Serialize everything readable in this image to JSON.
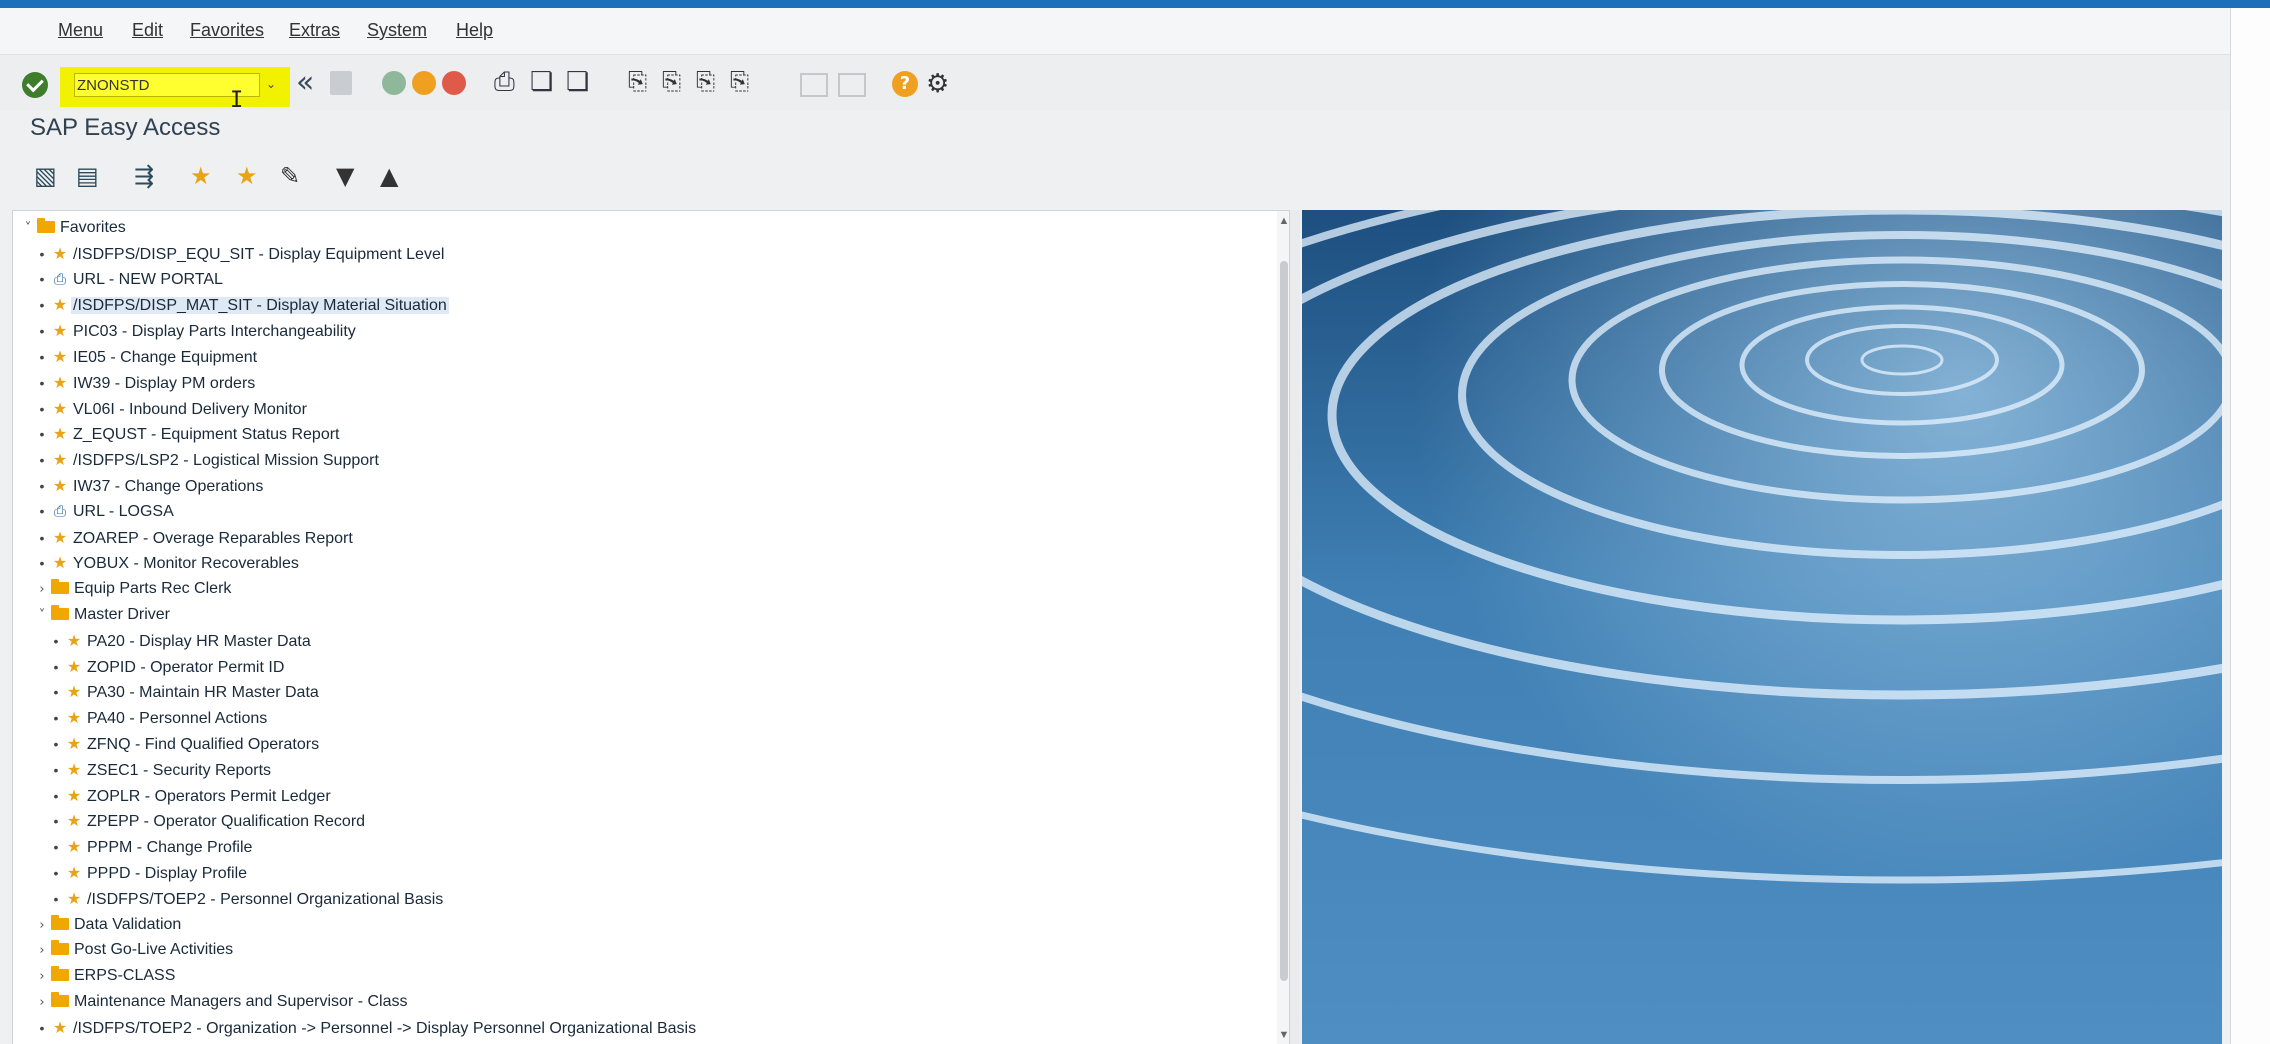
{
  "menu": [
    "Menu",
    "Edit",
    "Favorites",
    "Extras",
    "System",
    "Help"
  ],
  "command": {
    "value": "ZNONSTD"
  },
  "title": "SAP Easy Access",
  "tree": [
    {
      "level": 0,
      "type": "folder",
      "expanded": true,
      "label": "Favorites"
    },
    {
      "level": 1,
      "type": "star",
      "label": "/ISDFPS/DISP_EQU_SIT - Display Equipment Level"
    },
    {
      "level": 1,
      "type": "doc",
      "label": "URL - NEW PORTAL"
    },
    {
      "level": 1,
      "type": "star",
      "label": "/ISDFPS/DISP_MAT_SIT - Display Material Situation",
      "selected": true
    },
    {
      "level": 1,
      "type": "star",
      "label": "PIC03 - Display Parts Interchangeability"
    },
    {
      "level": 1,
      "type": "star",
      "label": "IE05 - Change Equipment"
    },
    {
      "level": 1,
      "type": "star",
      "label": "IW39 - Display PM orders"
    },
    {
      "level": 1,
      "type": "star",
      "label": "VL06I - Inbound Delivery Monitor"
    },
    {
      "level": 1,
      "type": "star",
      "label": "Z_EQUST - Equipment Status Report"
    },
    {
      "level": 1,
      "type": "star",
      "label": "/ISDFPS/LSP2 - Logistical Mission Support"
    },
    {
      "level": 1,
      "type": "star",
      "label": "IW37 - Change Operations"
    },
    {
      "level": 1,
      "type": "doc",
      "label": "URL - LOGSA"
    },
    {
      "level": 1,
      "type": "star",
      "label": "ZOAREP - Overage Reparables Report"
    },
    {
      "level": 1,
      "type": "star",
      "label": "YOBUX - Monitor Recoverables"
    },
    {
      "level": 1,
      "type": "folder",
      "expanded": false,
      "label": "Equip Parts Rec Clerk"
    },
    {
      "level": 1,
      "type": "folder",
      "expanded": true,
      "label": "Master Driver"
    },
    {
      "level": 2,
      "type": "star",
      "label": "PA20 - Display HR Master Data"
    },
    {
      "level": 2,
      "type": "star",
      "label": "ZOPID - Operator Permit ID"
    },
    {
      "level": 2,
      "type": "star",
      "label": "PA30 - Maintain HR Master Data"
    },
    {
      "level": 2,
      "type": "star",
      "label": "PA40 - Personnel Actions"
    },
    {
      "level": 2,
      "type": "star",
      "label": "ZFNQ - Find Qualified Operators"
    },
    {
      "level": 2,
      "type": "star",
      "label": "ZSEC1 - Security Reports"
    },
    {
      "level": 2,
      "type": "star",
      "label": "ZOPLR - Operators Permit Ledger"
    },
    {
      "level": 2,
      "type": "star",
      "label": "ZPEPP - Operator Qualification Record"
    },
    {
      "level": 2,
      "type": "star",
      "label": "PPPM - Change Profile"
    },
    {
      "level": 2,
      "type": "star",
      "label": "PPPD - Display Profile"
    },
    {
      "level": 2,
      "type": "star",
      "label": "/ISDFPS/TOEP2 - Personnel Organizational Basis"
    },
    {
      "level": 1,
      "type": "folder",
      "expanded": false,
      "label": "Data Validation"
    },
    {
      "level": 1,
      "type": "folder",
      "expanded": false,
      "label": "Post Go-Live Activities"
    },
    {
      "level": 1,
      "type": "folder",
      "expanded": false,
      "label": "ERPS-CLASS"
    },
    {
      "level": 1,
      "type": "folder",
      "expanded": false,
      "label": "Maintenance Managers and Supervisor - Class"
    },
    {
      "level": 1,
      "type": "star",
      "label": "/ISDFPS/TOEP2 - Organization -> Personnel -> Display Personnel Organizational Basis"
    }
  ],
  "colors": {
    "accent": "#1c6fb8",
    "highlight": "#f2f200",
    "star": "#e8a317",
    "folder": "#f0a800",
    "ok": "#3e7d2b"
  }
}
